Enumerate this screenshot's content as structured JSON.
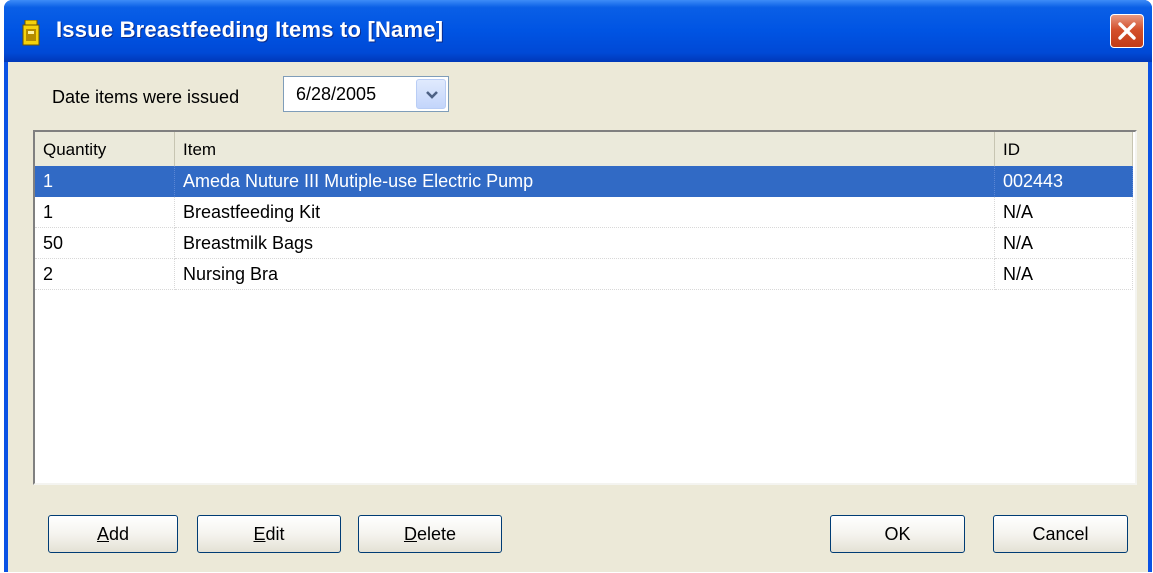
{
  "window": {
    "title": "Issue Breastfeeding Items to [Name]"
  },
  "date": {
    "label": "Date items were issued",
    "value": "6/28/2005"
  },
  "list": {
    "columns": [
      "Quantity",
      "Item",
      "ID"
    ],
    "rows": [
      {
        "quantity": "1",
        "item": "Ameda Nuture III Mutiple-use Electric Pump",
        "id": "002443",
        "selected": true
      },
      {
        "quantity": "1",
        "item": "Breastfeeding Kit",
        "id": "N/A",
        "selected": false
      },
      {
        "quantity": "50",
        "item": "Breastmilk Bags",
        "id": "N/A",
        "selected": false
      },
      {
        "quantity": "2",
        "item": "Nursing Bra",
        "id": "N/A",
        "selected": false
      }
    ]
  },
  "buttons": {
    "add": {
      "mnemonic": "A",
      "rest": "dd"
    },
    "edit": {
      "mnemonic": "E",
      "rest": "dit"
    },
    "delete": {
      "mnemonic": "D",
      "rest": "elete"
    },
    "ok": "OK",
    "cancel": "Cancel"
  },
  "colors": {
    "titlebar": "#0054e3",
    "selection": "#316ac5",
    "client": "#ece9d8",
    "close_button": "#d4512c"
  },
  "icons": {
    "app": "breast-pump-icon",
    "close": "close-icon",
    "dropdown": "chevron-down-icon"
  }
}
